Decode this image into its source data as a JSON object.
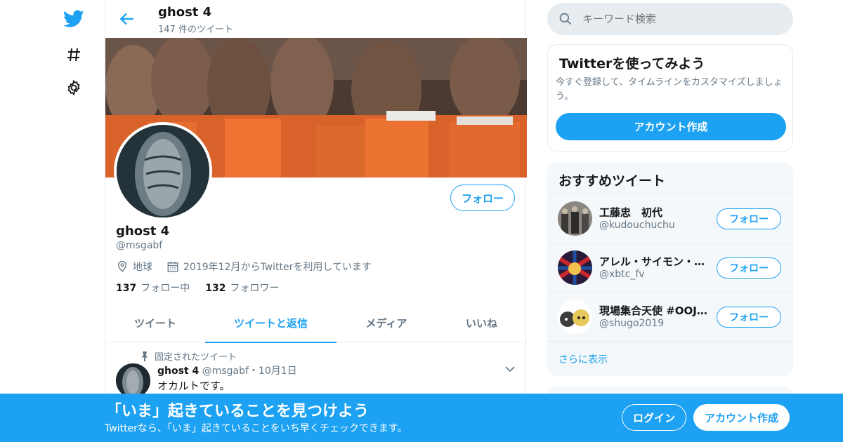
{
  "colors": {
    "accent": "#1da1f2",
    "muted": "#657786",
    "text": "#14171a",
    "border": "#e6ecf0"
  },
  "nav": {
    "icons": [
      "twitter-logo-icon",
      "hashtag-icon",
      "gear-icon"
    ]
  },
  "header": {
    "name": "ghost 4",
    "tweet_count": "147 件のツイート"
  },
  "profile": {
    "follow_label": "フォロー",
    "name": "ghost 4",
    "handle": "@msgabf",
    "location": "地球",
    "joined": "2019年12月からTwitterを利用しています",
    "following_count": "137",
    "following_label": "フォロー中",
    "followers_count": "132",
    "followers_label": "フォロワー"
  },
  "tabs": [
    {
      "label": "ツイート",
      "active": false
    },
    {
      "label": "ツイートと返信",
      "active": true
    },
    {
      "label": "メディア",
      "active": false
    },
    {
      "label": "いいね",
      "active": false
    }
  ],
  "pinned_tweet": {
    "pinned_label": "固定されたツイート",
    "author": "ghost 4",
    "handle": "@msgabf",
    "date": "・10月1日",
    "text": "オカルトです。"
  },
  "search": {
    "placeholder": "キーワード検索"
  },
  "try_twitter": {
    "title": "Twitterを使ってみよう",
    "description": "今すぐ登録して、タイムラインをカスタマイズしましょう。",
    "button": "アカウント作成"
  },
  "recommended": {
    "title": "おすすめツイート",
    "items": [
      {
        "name": "工藤忠　初代",
        "handle": "@kudouchuchu",
        "button": "フォロー"
      },
      {
        "name": "アレル・サイモン・ホワイト",
        "handle": "@xbtc_fv",
        "button": "フォロー"
      },
      {
        "name": "現場集合天使 #OOJ 配信中",
        "handle": "@shugo2019",
        "button": "フォロー"
      }
    ],
    "more": "さらに表示"
  },
  "bottom_bar": {
    "title": "「いま」起きていることを見つけよう",
    "subtitle": "Twitterなら、「いま」起きていることをいち早くチェックできます。",
    "login": "ログイン",
    "signup": "アカウント作成"
  }
}
